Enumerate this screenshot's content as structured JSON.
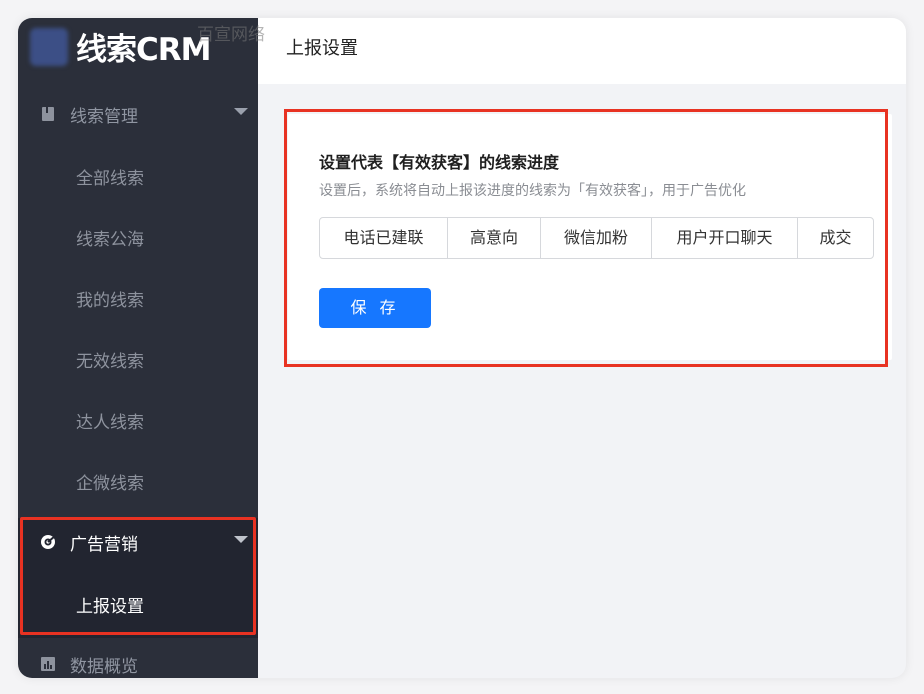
{
  "app": {
    "logo_text": "线索CRM",
    "watermark": "百宣网络"
  },
  "sidebar": {
    "groups": [
      {
        "label": "线索管理",
        "icon": "book-icon"
      },
      {
        "label": "广告营销",
        "icon": "target-icon"
      },
      {
        "label": "数据概览",
        "icon": "bar-chart-icon"
      }
    ],
    "lead_items": [
      "全部线索",
      "线索公海",
      "我的线索",
      "无效线索",
      "达人线索",
      "企微线索"
    ],
    "ad_items": [
      "上报设置"
    ]
  },
  "header": {
    "title": "上报设置"
  },
  "main": {
    "heading": "设置代表【有效获客】的线索进度",
    "description": "设置后，系统将自动上报该进度的线索为「有效获客」，用于广告优化",
    "stages": [
      "电话已建联",
      "高意向",
      "微信加粉",
      "用户开口聊天",
      "成交"
    ],
    "save_label": "保 存"
  },
  "colors": {
    "sidebar_bg": "#2b2f3a",
    "primary": "#1677ff",
    "highlight": "#e83222"
  }
}
